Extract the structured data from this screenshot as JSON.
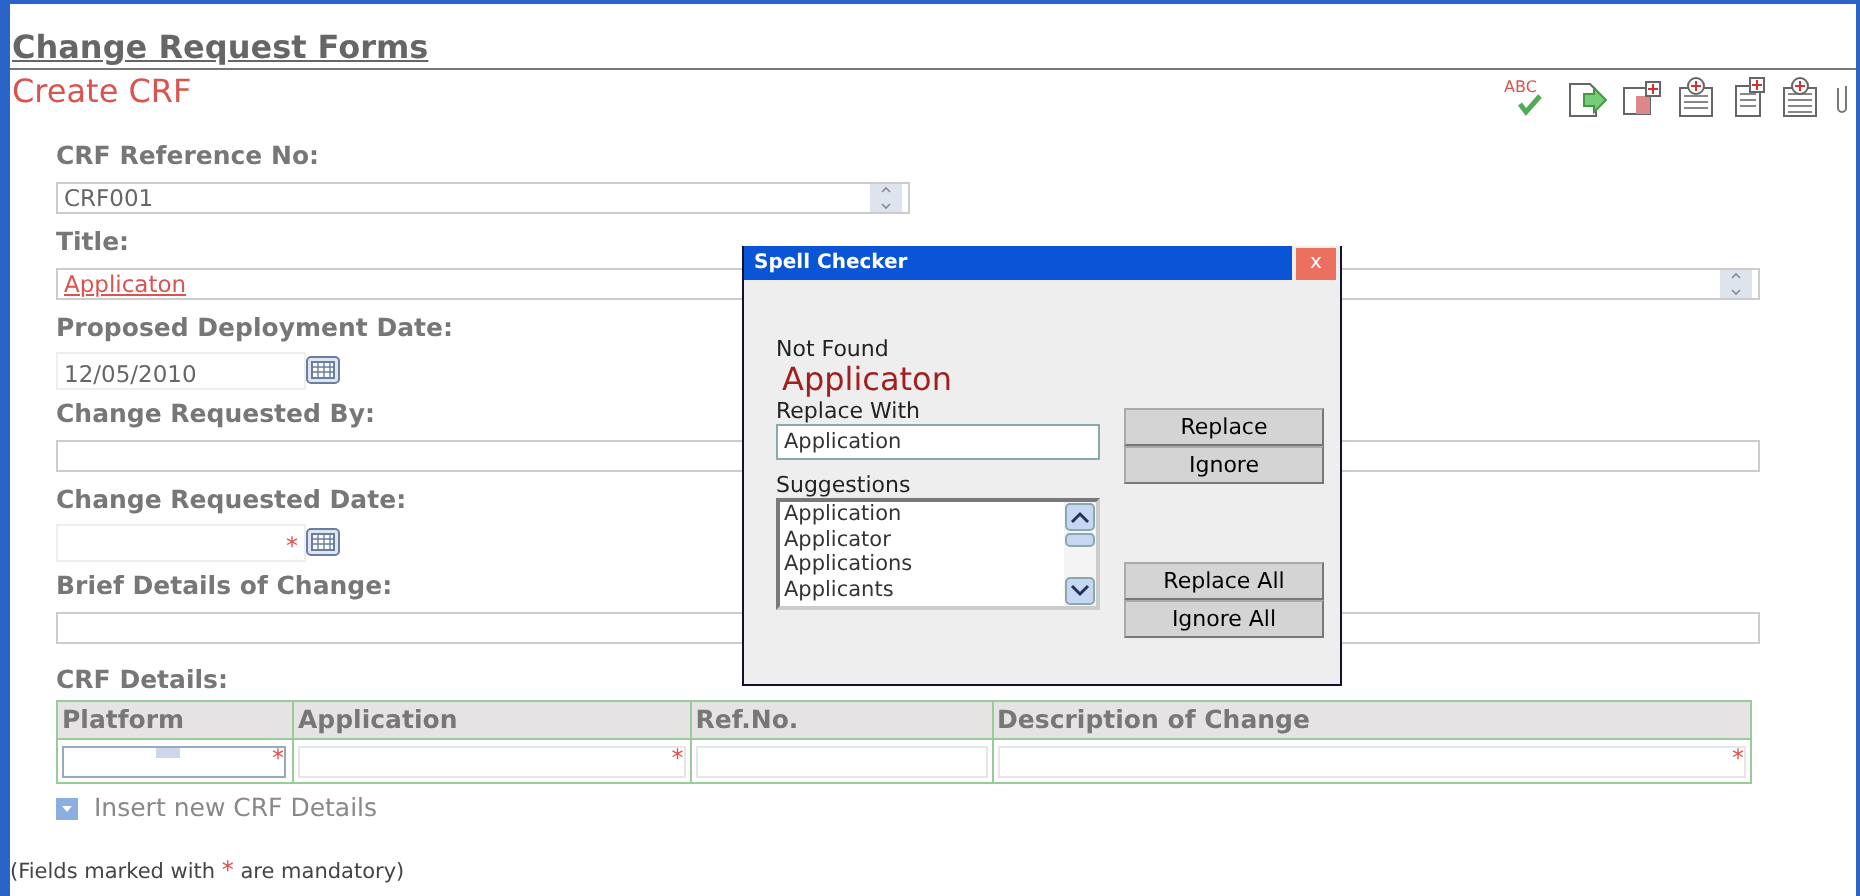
{
  "page_title": "Change Request Forms",
  "form_title": "Create CRF",
  "toolbar": {
    "spell_text": "ABC"
  },
  "fields": [
    {
      "label": "CRF Reference No:",
      "kind": "short-spinner",
      "value": "CRF001",
      "required": false,
      "misspelled": false
    },
    {
      "label": "Title:",
      "kind": "spinner",
      "value": "Applicaton",
      "required": false,
      "misspelled": true
    },
    {
      "label": "Proposed Deployment Date:",
      "kind": "date",
      "value": "12/05/2010",
      "required": false,
      "misspelled": false
    },
    {
      "label": "Change Requested By:",
      "kind": "text",
      "required": false
    },
    {
      "label": "Change Requested Date:",
      "kind": "date",
      "required": true
    },
    {
      "label": "Brief Details of Change:",
      "kind": "text",
      "required": false
    }
  ],
  "details": {
    "label": "CRF Details:",
    "columns": [
      "Platform",
      "Application",
      "Ref.No.",
      "Description of Change"
    ],
    "row": [
      {
        "kind": "dropdown",
        "required": true
      },
      {
        "kind": "text",
        "required": true
      },
      {
        "kind": "text",
        "required": false
      },
      {
        "kind": "text",
        "required": true
      }
    ],
    "insert_link": "Insert new CRF Details"
  },
  "note": {
    "before": "(Fields marked with ",
    "mark": "*",
    "after": " are mandatory)"
  },
  "dialog": {
    "title": "Spell Checker",
    "close": "x",
    "not_found_label": "Not Found",
    "not_found_word": "Applicaton",
    "replace_label": "Replace With",
    "replace_value": "Application",
    "suggestions_label": "Suggestions",
    "suggestions": [
      "Application",
      "Applicator",
      "Applications",
      "Applicants"
    ],
    "buttons": [
      "Replace",
      "Ignore",
      "Replace All",
      "Ignore All"
    ]
  }
}
